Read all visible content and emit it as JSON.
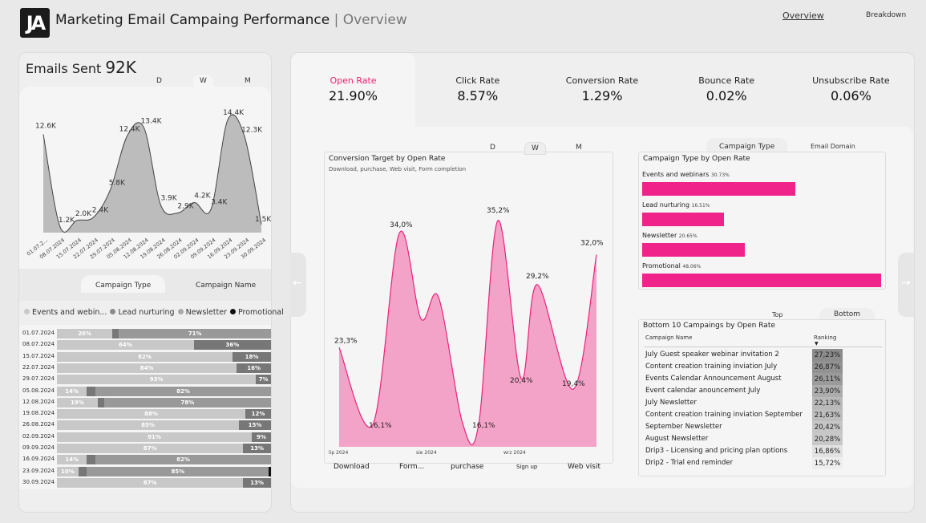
{
  "header": {
    "logo_text": "JA",
    "title": "Marketing Email Campaing Performance",
    "separator": "|",
    "subtitle": "Overview",
    "nav": {
      "overview": "Overview",
      "breakdown": "Breakdown"
    }
  },
  "emails_sent": {
    "label": "Emails Sent",
    "value": "92K"
  },
  "period_toggle": {
    "d": "D",
    "w": "W",
    "m": "M",
    "active": "W"
  },
  "line_chart": {
    "x": [
      "01.07.2...",
      "08.07.2024",
      "15.07.2024",
      "22.07.2024",
      "29.07.2024",
      "05.08.2024",
      "12.08.2024",
      "19.08.2024",
      "26.08.2024",
      "02.09.2024",
      "09.09.2024",
      "16.09.2024",
      "23.09.2024",
      "30.09.2024"
    ],
    "values": [
      12.6,
      1.2,
      2.0,
      2.4,
      5.8,
      12.4,
      13.4,
      3.9,
      2.9,
      4.2,
      3.4,
      14.4,
      12.3,
      1.5
    ],
    "labels": [
      "12.6K",
      "1.2K",
      "2.0K",
      "2.4K",
      "5.8K",
      "12.4K",
      "13.4K",
      "3.9K",
      "2.9K",
      "4.2K",
      "3.4K",
      "14.4K",
      "12.3K",
      "1.5K"
    ]
  },
  "left_tabs": {
    "campaign_type": "Campaign Type",
    "campaign_name": "Campaign Name"
  },
  "legend": [
    {
      "name": "Events and webin...",
      "color": "#c8c8c8"
    },
    {
      "name": "Lead nurturing",
      "color": "#8a8a8a"
    },
    {
      "name": "Newsletter",
      "color": "#a9a9a9"
    },
    {
      "name": "Promotional",
      "color": "#111111"
    }
  ],
  "stacked": [
    {
      "date": "01.07.2024",
      "segs": [
        {
          "v": 26,
          "c": "#c8c8c8",
          "l": "26%"
        },
        {
          "v": 3,
          "c": "#777777",
          "l": ""
        },
        {
          "v": 71,
          "c": "#999999",
          "l": "71%"
        }
      ]
    },
    {
      "date": "08.07.2024",
      "segs": [
        {
          "v": 64,
          "c": "#c8c8c8",
          "l": "64%"
        },
        {
          "v": 36,
          "c": "#777777",
          "l": "36%"
        }
      ]
    },
    {
      "date": "15.07.2024",
      "segs": [
        {
          "v": 82,
          "c": "#c8c8c8",
          "l": "82%"
        },
        {
          "v": 18,
          "c": "#777777",
          "l": "18%"
        }
      ]
    },
    {
      "date": "22.07.2024",
      "segs": [
        {
          "v": 84,
          "c": "#c8c8c8",
          "l": "84%"
        },
        {
          "v": 16,
          "c": "#777777",
          "l": "16%"
        }
      ]
    },
    {
      "date": "29.07.2024",
      "segs": [
        {
          "v": 93,
          "c": "#c8c8c8",
          "l": "93%"
        },
        {
          "v": 7,
          "c": "#777777",
          "l": "7%"
        }
      ]
    },
    {
      "date": "05.08.2024",
      "segs": [
        {
          "v": 14,
          "c": "#c8c8c8",
          "l": "14%"
        },
        {
          "v": 4,
          "c": "#777777",
          "l": ""
        },
        {
          "v": 82,
          "c": "#999999",
          "l": "82%"
        }
      ]
    },
    {
      "date": "12.08.2024",
      "segs": [
        {
          "v": 19,
          "c": "#c8c8c8",
          "l": "19%"
        },
        {
          "v": 3,
          "c": "#777777",
          "l": ""
        },
        {
          "v": 78,
          "c": "#999999",
          "l": "78%"
        }
      ]
    },
    {
      "date": "19.08.2024",
      "segs": [
        {
          "v": 88,
          "c": "#c8c8c8",
          "l": "88%"
        },
        {
          "v": 12,
          "c": "#777777",
          "l": "12%"
        }
      ]
    },
    {
      "date": "26.08.2024",
      "segs": [
        {
          "v": 85,
          "c": "#c8c8c8",
          "l": "85%"
        },
        {
          "v": 15,
          "c": "#777777",
          "l": "15%"
        }
      ]
    },
    {
      "date": "02.09.2024",
      "segs": [
        {
          "v": 91,
          "c": "#c8c8c8",
          "l": "91%"
        },
        {
          "v": 9,
          "c": "#777777",
          "l": "9%"
        }
      ]
    },
    {
      "date": "09.09.2024",
      "segs": [
        {
          "v": 87,
          "c": "#c8c8c8",
          "l": "87%"
        },
        {
          "v": 13,
          "c": "#777777",
          "l": "13%"
        }
      ]
    },
    {
      "date": "16.09.2024",
      "segs": [
        {
          "v": 14,
          "c": "#c8c8c8",
          "l": "14%"
        },
        {
          "v": 4,
          "c": "#777777",
          "l": ""
        },
        {
          "v": 82,
          "c": "#999999",
          "l": "82%"
        }
      ]
    },
    {
      "date": "23.09.2024",
      "segs": [
        {
          "v": 10,
          "c": "#c8c8c8",
          "l": "10%"
        },
        {
          "v": 4,
          "c": "#777777",
          "l": ""
        },
        {
          "v": 85,
          "c": "#999999",
          "l": "85%"
        },
        {
          "v": 1,
          "c": "#111111",
          "l": ""
        }
      ]
    },
    {
      "date": "30.09.2024",
      "segs": [
        {
          "v": 87,
          "c": "#c8c8c8",
          "l": "87%"
        },
        {
          "v": 13,
          "c": "#777777",
          "l": "13%"
        }
      ]
    }
  ],
  "kpis": [
    {
      "label": "Open Rate",
      "value": "21.90%",
      "active": true
    },
    {
      "label": "Click Rate",
      "value": "8.57%",
      "active": false
    },
    {
      "label": "Conversion Rate",
      "value": "1.29%",
      "active": false
    },
    {
      "label": "Bounce Rate",
      "value": "0.02%",
      "active": false
    },
    {
      "label": "Unsubscribe Rate",
      "value": "0.06%",
      "active": false
    }
  ],
  "conversion": {
    "title": "Conversion Target by Open Rate",
    "subtitle": "Download, purchase, Web visit, Form completion",
    "period": {
      "d": "D",
      "w": "W",
      "m": "M"
    },
    "month_ticks": [
      "lip 2024",
      "sie 2024",
      "wrz 2024"
    ],
    "points": [
      {
        "v": 23.3,
        "l": "23,3%"
      },
      {
        "v": 16.1,
        "l": "16,1%"
      },
      {
        "v": 34.0,
        "l": "34,0%"
      },
      {
        "v": 26.0,
        "l": ""
      },
      {
        "v": 28.0,
        "l": ""
      },
      {
        "v": 16.2,
        "l": ""
      },
      {
        "v": 16.1,
        "l": "16,1%"
      },
      {
        "v": 35.2,
        "l": "35,2%"
      },
      {
        "v": 20.4,
        "l": "20,4%"
      },
      {
        "v": 29.2,
        "l": "29,2%"
      },
      {
        "v": 19.4,
        "l": "19,4%"
      },
      {
        "v": 32.0,
        "l": "32,0%"
      }
    ],
    "categories": [
      "Download",
      "Form...",
      "purchase",
      "Sign up",
      "Web visit"
    ]
  },
  "campaign_type": {
    "tabs": {
      "type": "Campaign Type",
      "domain": "Email Domain"
    },
    "title": "Campaign Type by Open Rate",
    "bars": [
      {
        "name": "Events and webinars",
        "pct": "30.73%",
        "value": 30.73
      },
      {
        "name": "Lead nurturing",
        "pct": "16.51%",
        "value": 16.51
      },
      {
        "name": "Newsletter",
        "pct": "20.65%",
        "value": 20.65
      },
      {
        "name": "Promotional",
        "pct": "48.06%",
        "value": 48.06
      }
    ]
  },
  "bottom10": {
    "tabs": {
      "top": "Top",
      "bottom": "Bottom"
    },
    "title": "Bottom 10 Campaings by Open Rate",
    "col_name": "Campaign Name",
    "col_rank": "Ranking",
    "rows": [
      {
        "name": "July Guest speaker webinar invitation 2",
        "rank": "27,23%",
        "shade": "#8c8c8c"
      },
      {
        "name": "Content creation training inviation July",
        "rank": "26,87%",
        "shade": "#929292"
      },
      {
        "name": "Events Calendar Announcement August",
        "rank": "26,11%",
        "shade": "#9b9b9b"
      },
      {
        "name": "Event calendar anouncement July",
        "rank": "23,90%",
        "shade": "#acacac"
      },
      {
        "name": "July Newsletter",
        "rank": "22,13%",
        "shade": "#b9b9b9"
      },
      {
        "name": "Content creation training inviation September",
        "rank": "21,63%",
        "shade": "#bdbdbd"
      },
      {
        "name": "September Newsletter",
        "rank": "20,42%",
        "shade": "#c6c6c6"
      },
      {
        "name": "August Newsletter",
        "rank": "20,28%",
        "shade": "#c8c8c8"
      },
      {
        "name": "Drip3 - Licensing and pricing plan options",
        "rank": "16,86%",
        "shade": "#e2e2e2"
      },
      {
        "name": "Drip2 - Trial end reminder",
        "rank": "15,72%",
        "shade": "#eeeeee"
      }
    ]
  }
}
